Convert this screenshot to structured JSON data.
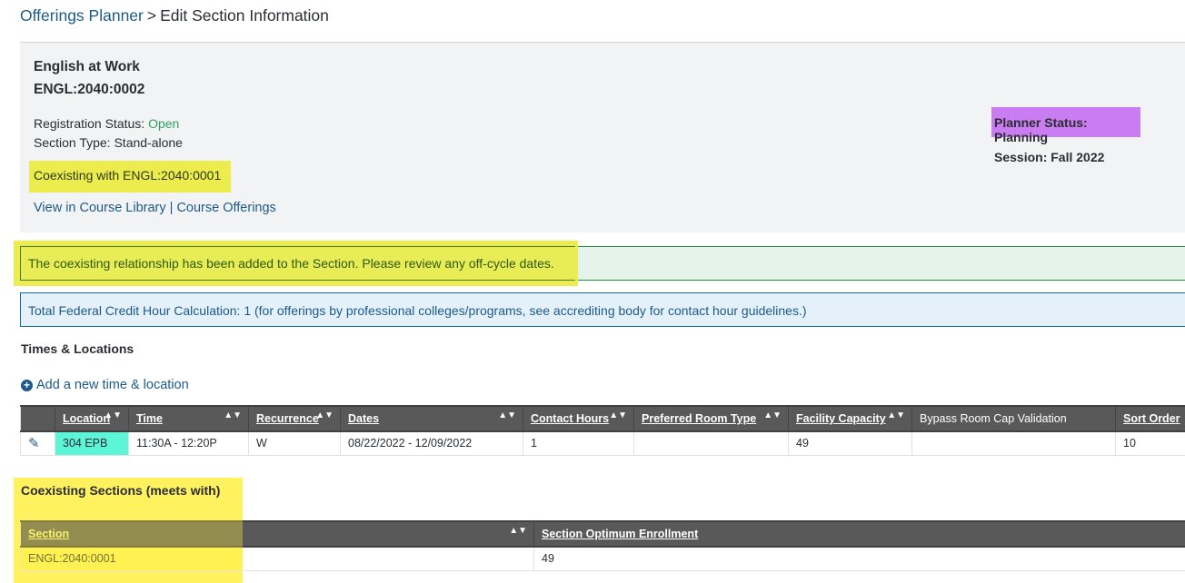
{
  "breadcrumb": {
    "parent": "Offerings Planner",
    "separator": ">",
    "current": "Edit Section Information"
  },
  "section": {
    "title": "English at Work",
    "code": "ENGL:2040:0002",
    "registration_status_label": "Registration Status:",
    "registration_status_value": "Open",
    "section_type": "Section Type: Stand-alone",
    "coexisting_with": "Coexisting with ENGL:2040:0001",
    "link_course_library": "View in Course Library",
    "link_separator": "|",
    "link_course_offerings": "Course Offerings",
    "planner_status": "Planner Status: Planning",
    "session": "Session: Fall 2022"
  },
  "alerts": {
    "success": "The coexisting relationship has been added to the Section. Please review any off-cycle dates.",
    "info": "Total Federal Credit Hour Calculation: 1 (for offerings by professional colleges/programs, see accrediting body for contact hour guidelines.)"
  },
  "times_locations": {
    "title": "Times & Locations",
    "add_label": "Add a new time & location",
    "columns": [
      "Location",
      "Time",
      "Recurrence",
      "Dates",
      "Contact Hours",
      "Preferred Room Type",
      "Facility Capacity",
      "Bypass Room Cap Validation",
      "Sort Order"
    ],
    "rows": [
      {
        "location": "304 EPB",
        "time": "11:30A - 12:20P",
        "recurrence": "W",
        "dates": "08/22/2022 - 12/09/2022",
        "contact_hours": "1",
        "preferred_room_type": "",
        "facility_capacity": "49",
        "bypass_room_cap_validation": "",
        "sort_order": "10"
      }
    ]
  },
  "coexisting_sections": {
    "title": "Coexisting Sections (meets with)",
    "columns": [
      "Section",
      "Section Optimum Enrollment"
    ],
    "rows": [
      {
        "section": "ENGL:2040:0001",
        "optimum_enrollment": "49"
      }
    ]
  },
  "colors": {
    "link": "#1d5a8a",
    "open_status": "#2ea065",
    "highlight_yellow": "#ecec4f",
    "highlight_purple": "#c97df0",
    "highlight_teal": "#5cf5d8",
    "table_header": "#595959"
  }
}
